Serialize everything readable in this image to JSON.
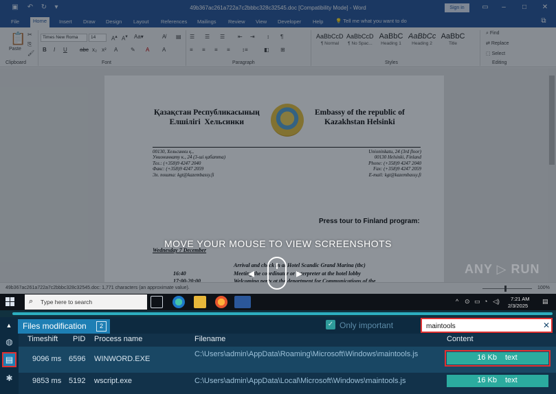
{
  "word": {
    "title": "49b367ac261a722a7c2bbbc328c32545.doc [Compatibility Mode] - Word",
    "signin_label": "Sign in",
    "tabs": [
      "File",
      "Home",
      "Insert",
      "Draw",
      "Design",
      "Layout",
      "References",
      "Mailings",
      "Review",
      "View",
      "Developer",
      "Help"
    ],
    "active_tab": "Home",
    "tell_me": "Tell me what you want to do",
    "ribbon": {
      "paste_label": "Paste",
      "font_name": "Times New Roma",
      "font_size": "14",
      "styles": [
        {
          "sample": "AaBbCcDc",
          "name": "¶ Normal"
        },
        {
          "sample": "AaBbCcDc",
          "name": "¶ No Spac..."
        },
        {
          "sample": "AaBbC",
          "name": "Heading 1"
        },
        {
          "sample": "AaBbCc",
          "name": "Heading 2"
        },
        {
          "sample": "AaBbC",
          "name": "Title"
        }
      ],
      "find_label": "Find",
      "replace_label": "Replace",
      "select_label": "Select",
      "groups": [
        "Clipboard",
        "Font",
        "Paragraph",
        "Styles",
        "Editing"
      ]
    },
    "document": {
      "header_left": "Қазақстан Республикасының\nЕлшілігі  Хельсинки",
      "header_right": "Embassy of the republic of\nKazakhstan Helsinki",
      "address_left": "00130, Хельсинки қ.,\nУнионинкату к., 24 (3-ші қабатта)\nТел.: (+358)9 4247 2040\nФакс: (+358)9 4247 2059\nЭл. пошта: kgt@kazembassy.fi",
      "address_right": "Unioninkatu, 24 (3rd floor)\n00130 Helsinki, Finland\nPhone: (+358)9 4247 2040\nFax: (+358)9 4247 2059\nE-mail: kgt@kazembassy.fi",
      "tour_title": "Press tour to Finland program:",
      "day_heading": "Wednesday 7 December",
      "lines": [
        {
          "time": "",
          "text": "Arrival and check in at Hotel Scandic Grand Marina (tbc)"
        },
        {
          "time": "16:40",
          "text": "Meeting the coordinator or interpreter at the hotel lobby"
        },
        {
          "time": "17:00-20:00",
          "text": "Welcoming party at the department for Communications of the"
        }
      ]
    },
    "status_text": "49b367ac261a722a7c2bbbc328c32545.doc: 1,771 characters (an approximate value).",
    "zoom": "100%"
  },
  "overlay": {
    "message": "MOVE YOUR MOUSE TO VIEW SCREENSHOTS",
    "watermark": "ANY ▷ RUN"
  },
  "taskbar": {
    "search_placeholder": "Type here to search",
    "time": "7:21 AM",
    "date": "2/3/2025"
  },
  "panel": {
    "title": "Files modification",
    "count": "2",
    "only_important_label": "Only important",
    "filter_value": "maintools",
    "columns": [
      "Timeshift",
      "PID",
      "Process name",
      "Filename",
      "Content"
    ],
    "rows": [
      {
        "timeshift": "9096 ms",
        "pid": "6596",
        "process": "WINWORD.EXE",
        "filename": "C:\\Users\\admin\\AppData\\Roaming\\Microsoft\\Windows\\maintools.js",
        "size": "16 Kb",
        "kind": "text"
      },
      {
        "timeshift": "9853 ms",
        "pid": "5192",
        "process": "wscript.exe",
        "filename": "C:\\Users\\admin\\AppData\\Local\\Microsoft\\Windows\\maintools.js",
        "size": "16 Kb",
        "kind": "text"
      }
    ]
  },
  "colors": {
    "word_blue": "#2b579a",
    "panel_bg": "#12324a",
    "tab_active": "#1e7fb4",
    "badge_teal": "#2bab9f",
    "highlight_red": "#e03131"
  }
}
